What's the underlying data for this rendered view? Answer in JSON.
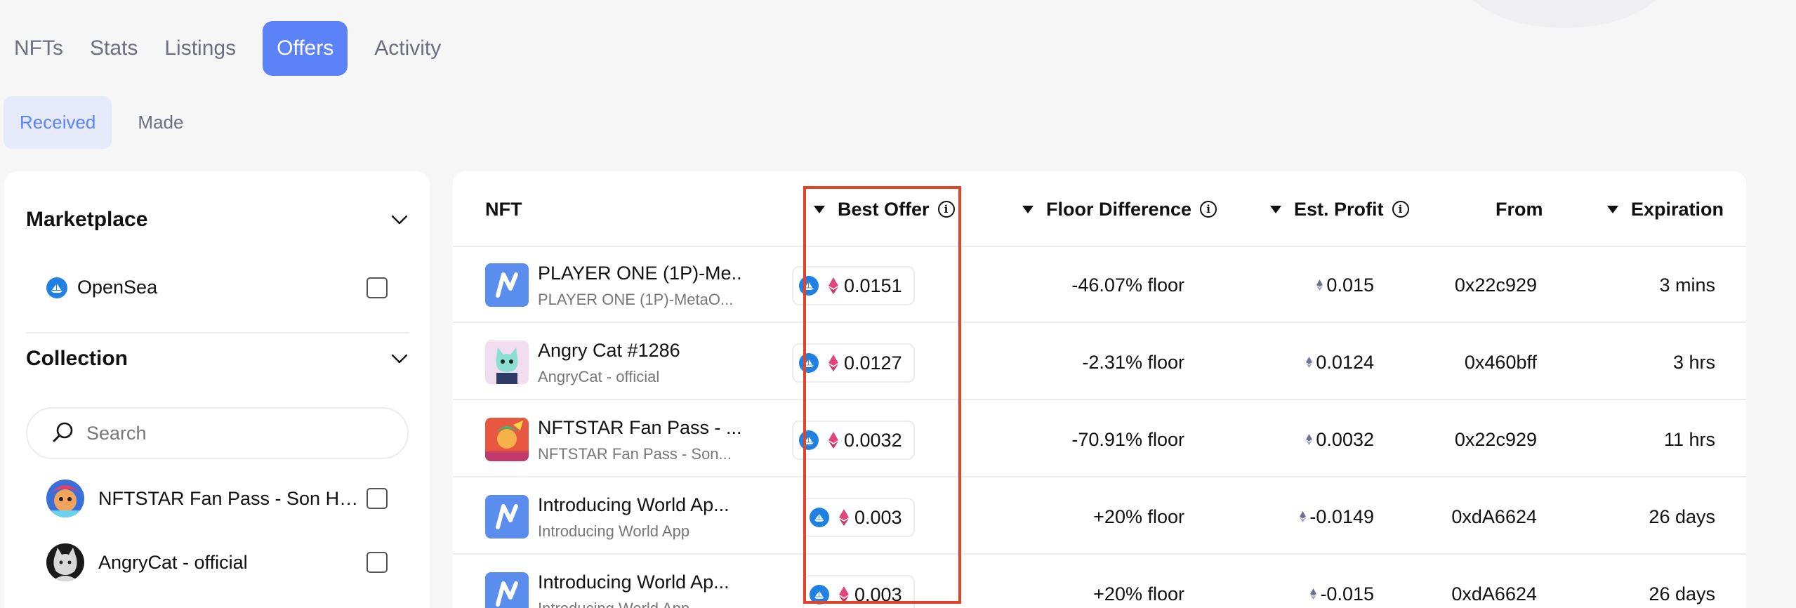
{
  "top_tabs": [
    {
      "label": "NFTs",
      "active": false
    },
    {
      "label": "Stats",
      "active": false
    },
    {
      "label": "Listings",
      "active": false
    },
    {
      "label": "Offers",
      "active": true
    },
    {
      "label": "Activity",
      "active": false
    }
  ],
  "sub_tabs": [
    {
      "label": "Received",
      "active": true
    },
    {
      "label": "Made",
      "active": false
    }
  ],
  "filters": {
    "marketplace": {
      "title": "Marketplace",
      "options": [
        {
          "label": "OpenSea",
          "checked": false
        }
      ]
    },
    "collection": {
      "title": "Collection",
      "search_placeholder": "Search",
      "options": [
        {
          "label": "NFTSTAR Fan Pass - Son Heung-min",
          "display": "NFTSTAR Fan Pass - Son Heu...",
          "checked": false
        },
        {
          "label": "AngryCat - official",
          "display": "AngryCat - official",
          "checked": false
        }
      ]
    }
  },
  "table": {
    "columns": {
      "nft": "NFT",
      "best_offer": "Best Offer",
      "floor_difference": "Floor Difference",
      "est_profit": "Est. Profit",
      "from": "From",
      "expiration": "Expiration"
    },
    "rows": [
      {
        "name": "PLAYER ONE (1P)-Me...",
        "collection": "PLAYER ONE (1P)-MetaO...",
        "best_offer": "0.0151",
        "floor_diff": "-46.07% floor",
        "est_profit": "0.015",
        "from": "0x22c929",
        "expiration": "3 mins",
        "thumb": "world-app-icon"
      },
      {
        "name": "Angry Cat #1286",
        "collection": "AngryCat - official",
        "best_offer": "0.0127",
        "floor_diff": "-2.31% floor",
        "est_profit": "0.0124",
        "from": "0x460bff",
        "expiration": "3 hrs",
        "thumb": "angry-cat-icon"
      },
      {
        "name": "NFTSTAR Fan Pass - ...",
        "collection": "NFTSTAR Fan Pass - Son...",
        "best_offer": "0.0032",
        "floor_diff": "-70.91% floor",
        "est_profit": "0.0032",
        "from": "0x22c929",
        "expiration": "11 hrs",
        "thumb": "nftstar-icon"
      },
      {
        "name": "Introducing World Ap...",
        "collection": "Introducing World App",
        "best_offer": "0.003",
        "floor_diff": "+20% floor",
        "est_profit": "-0.0149",
        "from": "0xdA6624",
        "expiration": "26 days",
        "thumb": "world-app-icon"
      },
      {
        "name": "Introducing World Ap...",
        "collection": "Introducing World App",
        "best_offer": "0.003",
        "floor_diff": "+20% floor",
        "est_profit": "-0.015",
        "from": "0xdA6624",
        "expiration": "26 days",
        "thumb": "world-app-icon"
      }
    ]
  },
  "colors": {
    "accent": "#5b82f7",
    "highlight": "#e0442a",
    "opensea": "#2081e2",
    "eth_pink": "#e0467c"
  }
}
